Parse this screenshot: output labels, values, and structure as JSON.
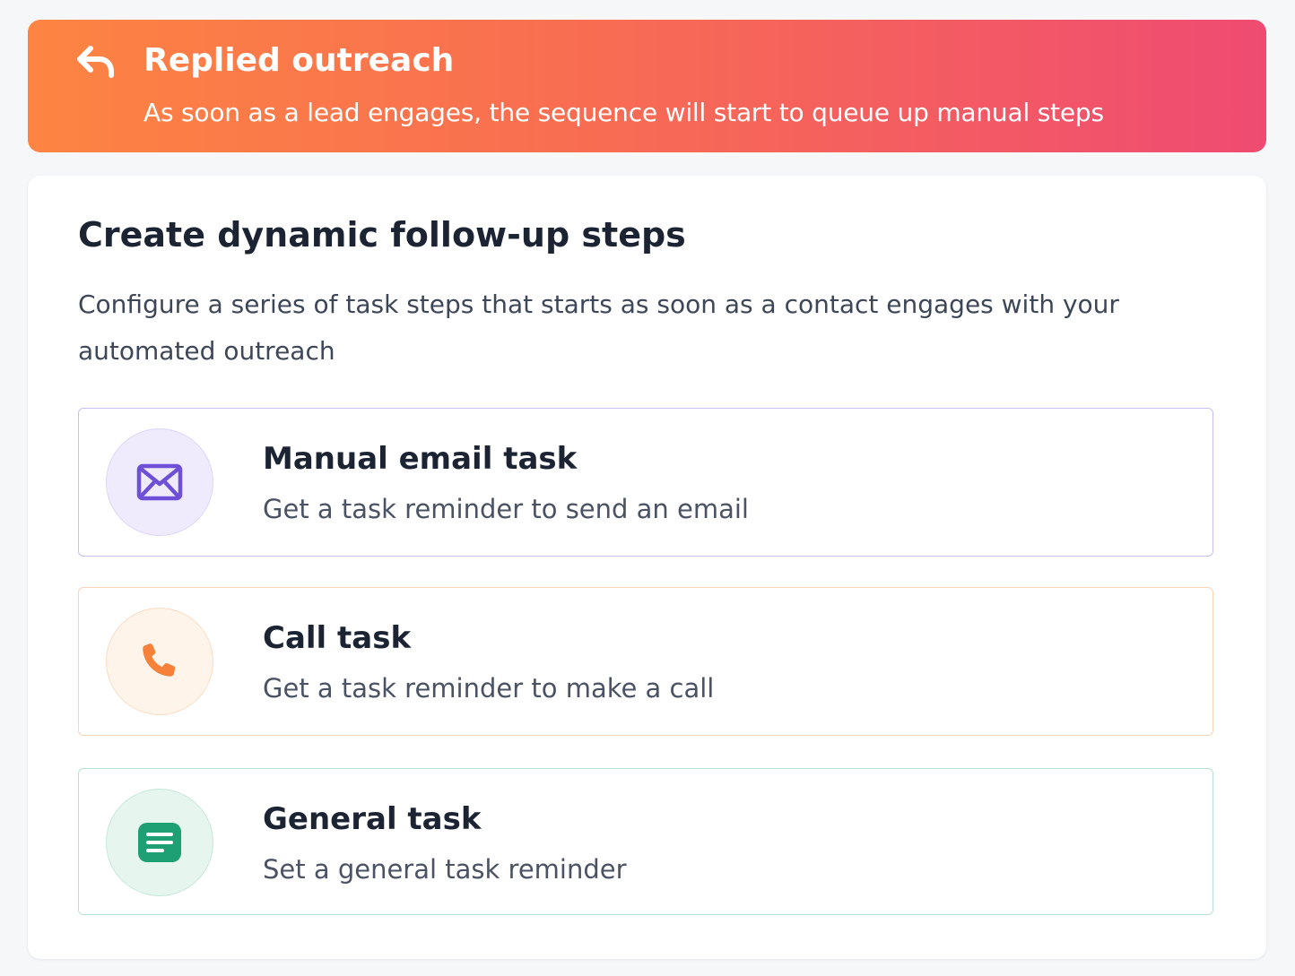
{
  "banner": {
    "icon": "reply-arrow-icon",
    "title": "Replied outreach",
    "subtitle": "As soon as a lead engages, the sequence will start to queue up manual steps"
  },
  "panel": {
    "title": "Create dynamic follow-up steps",
    "description": "Configure a series of task steps that starts as soon as a contact engages with your automated outreach"
  },
  "tasks": [
    {
      "icon": "envelope-icon",
      "title": "Manual email task",
      "subtitle": "Get a task reminder to send an email",
      "accent": "#6e4fd8"
    },
    {
      "icon": "phone-icon",
      "title": "Call task",
      "subtitle": "Get a task reminder to make a call",
      "accent": "#f5813a"
    },
    {
      "icon": "note-icon",
      "title": "General task",
      "subtitle": "Set a general task reminder",
      "accent": "#1f9f74"
    }
  ],
  "colors": {
    "banner_start": "#fd8442",
    "banner_end": "#ef4b72",
    "heading": "#1c2434"
  }
}
